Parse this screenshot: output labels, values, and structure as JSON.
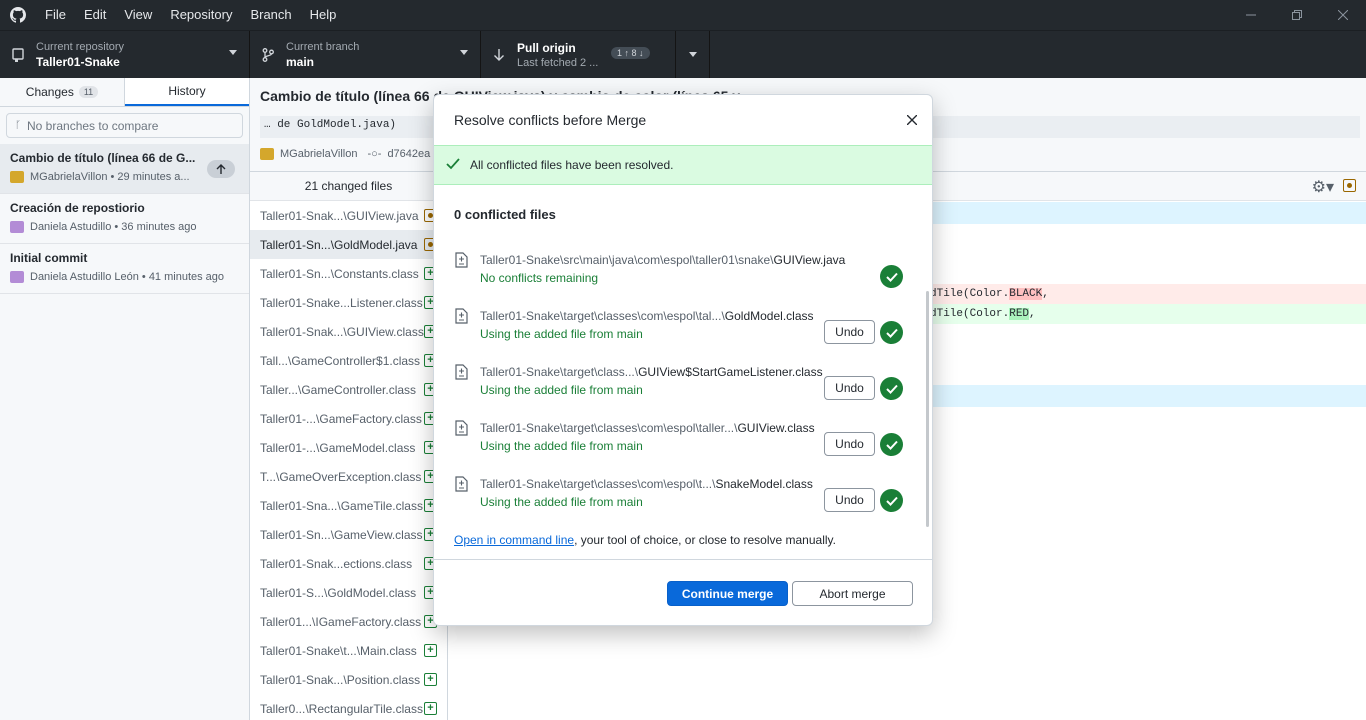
{
  "menu": [
    "File",
    "Edit",
    "View",
    "Repository",
    "Branch",
    "Help"
  ],
  "toolbar": {
    "repo_label": "Current repository",
    "repo_value": "Taller01-Snake",
    "branch_label": "Current branch",
    "branch_value": "main",
    "pull_label": "Pull origin",
    "pull_sub": "Last fetched 2 ...",
    "pull_badge": "1 ↑ 8 ↓"
  },
  "sidebar": {
    "tab_changes": "Changes",
    "tab_changes_count": "11",
    "tab_history": "History",
    "compare_placeholder": "No branches to compare",
    "commits": [
      {
        "title": "Cambio de título (línea 66 de G...",
        "meta": "MGabrielaVillon • 29 minutes a..."
      },
      {
        "title": "Creación de repostiorio",
        "meta": "Daniela Astudillo • 36 minutes ago"
      },
      {
        "title": "Initial commit",
        "meta": "Daniela Astudillo León • 41 minutes ago"
      }
    ]
  },
  "commit_header": {
    "title": "Cambio de título (línea 66 de GUIView.java) y cambio de color (línea 65 y",
    "desc": "… de GoldModel.java)",
    "author": "MGabrielaVillon",
    "sha": "d7642ea"
  },
  "files": {
    "header": "21 changed files",
    "items": [
      {
        "name": "Taller01-Snak...\\GUIView.java",
        "status": "modified"
      },
      {
        "name": "Taller01-Sn...\\GoldModel.java",
        "status": "modified"
      },
      {
        "name": "Taller01-Sn...\\Constants.class",
        "status": "added"
      },
      {
        "name": "Taller01-Snake...Listener.class",
        "status": "added"
      },
      {
        "name": "Taller01-Snak...\\GUIView.class",
        "status": "added"
      },
      {
        "name": "Tall...\\GameController$1.class",
        "status": "added"
      },
      {
        "name": "Taller...\\GameController.class",
        "status": "added"
      },
      {
        "name": "Taller01-...\\GameFactory.class",
        "status": "added"
      },
      {
        "name": "Taller01-...\\GameModel.class",
        "status": "added"
      },
      {
        "name": "T...\\GameOverException.class",
        "status": "added"
      },
      {
        "name": "Taller01-Sna...\\GameTile.class",
        "status": "added"
      },
      {
        "name": "Taller01-Sn...\\GameView.class",
        "status": "added"
      },
      {
        "name": "Taller01-Snak...ections.class",
        "status": "added"
      },
      {
        "name": "Taller01-S...\\GoldModel.class",
        "status": "added"
      },
      {
        "name": "Taller01...\\IGameFactory.class",
        "status": "added"
      },
      {
        "name": "Taller01-Snake\\t...\\Main.class",
        "status": "added"
      },
      {
        "name": "Taller01-Snak...\\Position.class",
        "status": "added"
      },
      {
        "name": "Taller0...\\RectangularTile.class",
        "status": "added"
      }
    ]
  },
  "diff": {
    "del_prefix": "dTile(Color.",
    "del_hl": "BLACK",
    "del_suffix": ",",
    "add_prefix": "dTile(Color.",
    "add_hl": "RED",
    "add_suffix": ","
  },
  "dialog": {
    "title": "Resolve conflicts before Merge",
    "banner": "All conflicted files have been resolved.",
    "count": "0 conflicted files",
    "conflicts": [
      {
        "dir": "Taller01-Snake\\src\\main\\java\\com\\espol\\taller01\\snake\\",
        "file": "GUIView.java",
        "status": "No conflicts remaining",
        "undo": ""
      },
      {
        "dir": "Taller01-Snake\\target\\classes\\com\\espol\\tal...\\",
        "file": "GoldModel.class",
        "status": "Using the added file from main",
        "undo": "Undo"
      },
      {
        "dir": "Taller01-Snake\\target\\class...\\",
        "file": "GUIView$StartGameListener.class",
        "status": "Using the added file from main",
        "undo": "Undo"
      },
      {
        "dir": "Taller01-Snake\\target\\classes\\com\\espol\\taller...\\",
        "file": "GUIView.class",
        "status": "Using the added file from main",
        "undo": "Undo"
      },
      {
        "dir": "Taller01-Snake\\target\\classes\\com\\espol\\t...\\",
        "file": "SnakeModel.class",
        "status": "Using the added file from main",
        "undo": "Undo"
      }
    ],
    "cmd_link": "Open in command line",
    "cmd_rest": ", your tool of choice, or close to resolve manually.",
    "continue": "Continue merge",
    "abort": "Abort merge"
  }
}
